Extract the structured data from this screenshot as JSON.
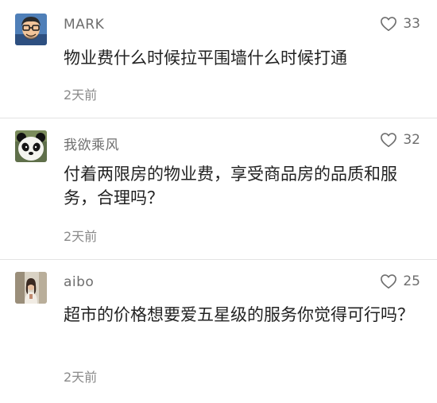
{
  "comments": [
    {
      "username": "MARK",
      "likes": "33",
      "text": "物业费什么时候拉平围墙什么时候打通",
      "time": "2天前",
      "avatar_icon": "man-glasses-avatar-icon"
    },
    {
      "username": "我欲乘风",
      "likes": "32",
      "text": "付着两限房的物业费，享受商品房的品质和服务，合理吗？",
      "time": "2天前",
      "avatar_icon": "panda-avatar-icon"
    },
    {
      "username": "aibo",
      "likes": "25",
      "text": "超市的价格想要爱五星级的服务你觉得可行吗？",
      "time": "2天前",
      "avatar_icon": "woman-photo-avatar-icon"
    }
  ],
  "colors": {
    "username": "#6e6e6e",
    "text": "#222222",
    "meta": "#8a8a8a",
    "divider": "#e3e3e3"
  }
}
